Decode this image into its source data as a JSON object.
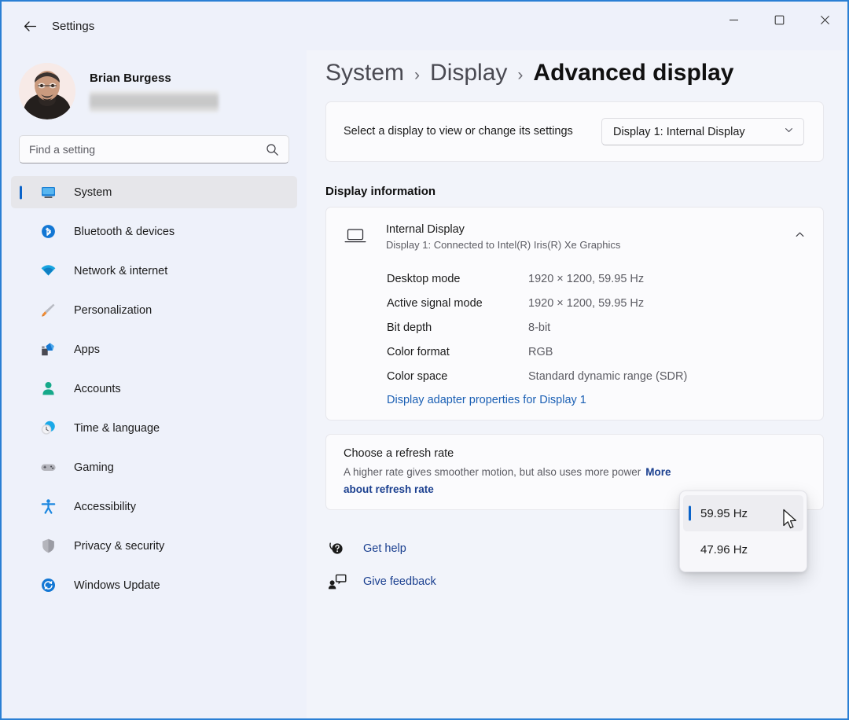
{
  "window": {
    "title": "Settings",
    "back_icon": "back-arrow-icon",
    "controls": {
      "minimize": "minimize-icon",
      "maximize": "maximize-icon",
      "close": "close-icon"
    }
  },
  "sidebar": {
    "profile": {
      "name": "Brian Burgess",
      "email_redacted": ""
    },
    "search": {
      "placeholder": "Find a setting",
      "value": "",
      "icon": "search-icon"
    },
    "items": [
      {
        "label": "System",
        "icon": "monitor-icon",
        "active": true
      },
      {
        "label": "Bluetooth & devices",
        "icon": "bluetooth-icon",
        "active": false
      },
      {
        "label": "Network & internet",
        "icon": "wifi-icon",
        "active": false
      },
      {
        "label": "Personalization",
        "icon": "paintbrush-icon",
        "active": false
      },
      {
        "label": "Apps",
        "icon": "apps-icon",
        "active": false
      },
      {
        "label": "Accounts",
        "icon": "person-icon",
        "active": false
      },
      {
        "label": "Time & language",
        "icon": "clock-icon",
        "active": false
      },
      {
        "label": "Gaming",
        "icon": "gamepad-icon",
        "active": false
      },
      {
        "label": "Accessibility",
        "icon": "accessibility-icon",
        "active": false
      },
      {
        "label": "Privacy & security",
        "icon": "shield-icon",
        "active": false
      },
      {
        "label": "Windows Update",
        "icon": "update-icon",
        "active": false
      }
    ]
  },
  "main": {
    "breadcrumb": {
      "crumb1": "System",
      "sep1": "›",
      "crumb2": "Display",
      "sep2": "›",
      "current": "Advanced display"
    },
    "select_display": {
      "label": "Select a display to view or change its settings",
      "dropdown_value": "Display 1: Internal Display",
      "chevron": "chevron-down-icon"
    },
    "display_information": {
      "section_title": "Display information",
      "header": {
        "title": "Internal Display",
        "subtitle": "Display 1: Connected to Intel(R) Iris(R) Xe Graphics",
        "icon": "laptop-display-icon",
        "expander": "chevron-up-icon"
      },
      "rows": [
        {
          "key": "Desktop mode",
          "value": "1920 × 1200, 59.95 Hz"
        },
        {
          "key": "Active signal mode",
          "value": "1920 × 1200, 59.95 Hz"
        },
        {
          "key": "Bit depth",
          "value": "8-bit"
        },
        {
          "key": "Color format",
          "value": "RGB"
        },
        {
          "key": "Color space",
          "value": "Standard dynamic range (SDR)"
        }
      ],
      "adapter_link": "Display adapter properties for Display 1"
    },
    "refresh_rate": {
      "title": "Choose a refresh rate",
      "description": "A higher rate gives smoother motion, but also uses more power",
      "more_link": "More about refresh rate",
      "options": [
        {
          "label": "59.95 Hz",
          "selected": true
        },
        {
          "label": "47.96 Hz",
          "selected": false
        }
      ]
    },
    "bottom_links": [
      {
        "label": "Get help",
        "icon": "help-icon"
      },
      {
        "label": "Give feedback",
        "icon": "feedback-icon"
      }
    ]
  },
  "colors": {
    "accent": "#0a63c9",
    "link": "#1a3f8f",
    "page_bg": "#f2f4fa",
    "card_bg": "#fbfbfd",
    "sidebar_bg": "#eef1fa"
  }
}
